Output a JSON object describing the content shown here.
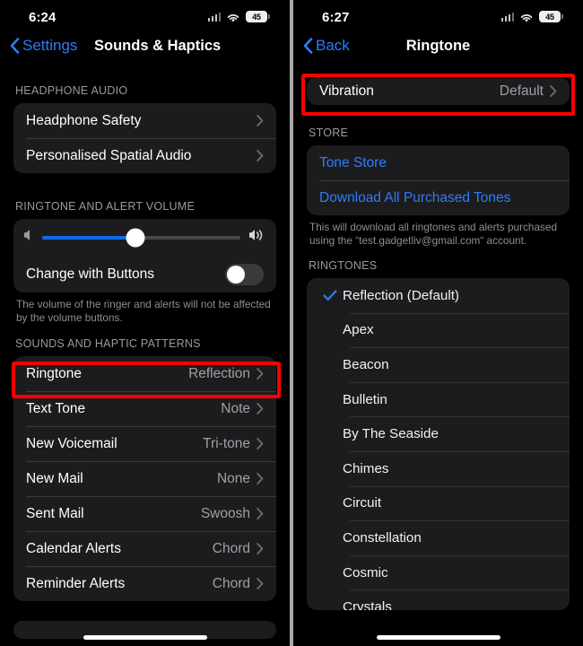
{
  "left": {
    "status": {
      "time": "6:24",
      "battery": "45",
      "cell_icon": "cellular-bars-icon",
      "wifi_icon": "wifi-icon"
    },
    "nav": {
      "back_label": "Settings",
      "title": "Sounds & Haptics",
      "back_icon": "chevron-left-icon"
    },
    "sections": {
      "headphone_audio": {
        "header": "HEADPHONE AUDIO",
        "rows": [
          {
            "label": "Headphone Safety",
            "value": ""
          },
          {
            "label": "Personalised Spatial Audio",
            "value": ""
          }
        ]
      },
      "volume": {
        "header": "RINGTONE AND ALERT VOLUME",
        "slider": {
          "value_percent": 47,
          "min_icon": "speaker-low-icon",
          "max_icon": "speaker-high-icon"
        },
        "toggle_row": {
          "label": "Change with Buttons",
          "state": "off"
        },
        "footnote": "The volume of the ringer and alerts will not be affected by the volume buttons."
      },
      "patterns": {
        "header": "SOUNDS AND HAPTIC PATTERNS",
        "rows": [
          {
            "label": "Ringtone",
            "value": "Reflection"
          },
          {
            "label": "Text Tone",
            "value": "Note"
          },
          {
            "label": "New Voicemail",
            "value": "Tri-tone"
          },
          {
            "label": "New Mail",
            "value": "None"
          },
          {
            "label": "Sent Mail",
            "value": "Swoosh"
          },
          {
            "label": "Calendar Alerts",
            "value": "Chord"
          },
          {
            "label": "Reminder Alerts",
            "value": "Chord"
          }
        ]
      }
    }
  },
  "right": {
    "status": {
      "time": "6:27",
      "battery": "45",
      "cell_icon": "cellular-bars-icon",
      "wifi_icon": "wifi-icon"
    },
    "nav": {
      "back_label": "Back",
      "title": "Ringtone",
      "back_icon": "chevron-left-icon"
    },
    "vibration_row": {
      "label": "Vibration",
      "value": "Default"
    },
    "store": {
      "header": "STORE",
      "rows": [
        {
          "label": "Tone Store"
        },
        {
          "label": "Download All Purchased Tones"
        }
      ],
      "footnote": "This will download all ringtones and alerts purchased using the “test.gadgetliv@gmail.com“ account."
    },
    "ringtones": {
      "header": "RINGTONES",
      "items": [
        {
          "name": "Reflection (Default)",
          "selected": true
        },
        {
          "name": "Apex",
          "selected": false
        },
        {
          "name": "Beacon",
          "selected": false
        },
        {
          "name": "Bulletin",
          "selected": false
        },
        {
          "name": "By The Seaside",
          "selected": false
        },
        {
          "name": "Chimes",
          "selected": false
        },
        {
          "name": "Circuit",
          "selected": false
        },
        {
          "name": "Constellation",
          "selected": false
        },
        {
          "name": "Cosmic",
          "selected": false
        },
        {
          "name": "Crystals",
          "selected": false
        }
      ]
    }
  },
  "colors": {
    "accent": "#2f7cf6",
    "highlight": "#ff0000",
    "card": "#1c1c1e",
    "slider_fill": "#1169e8"
  }
}
